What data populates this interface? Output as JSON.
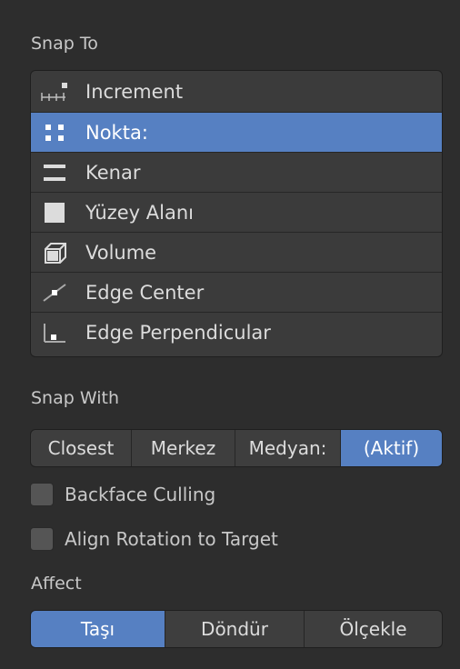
{
  "snap_to": {
    "label": "Snap To",
    "items": [
      {
        "label": "Increment",
        "icon": "increment-icon",
        "active": false
      },
      {
        "label": "Nokta:",
        "icon": "vertex-icon",
        "active": true
      },
      {
        "label": "Kenar",
        "icon": "edge-icon",
        "active": false
      },
      {
        "label": "Yüzey Alanı",
        "icon": "face-icon",
        "active": false
      },
      {
        "label": "Volume",
        "icon": "volume-icon",
        "active": false
      },
      {
        "label": "Edge Center",
        "icon": "edge-center-icon",
        "active": false
      },
      {
        "label": "Edge Perpendicular",
        "icon": "edge-perpendicular-icon",
        "active": false
      }
    ]
  },
  "snap_with": {
    "label": "Snap With",
    "options": [
      "Closest",
      "Merkez",
      "Medyan:",
      "(Aktif)"
    ],
    "selected": "(Aktif)"
  },
  "checkboxes": {
    "backface_culling": {
      "label": "Backface Culling",
      "checked": false
    },
    "align_rotation": {
      "label": "Align Rotation to Target",
      "checked": false
    }
  },
  "affect": {
    "label": "Affect",
    "options": [
      "Taşı",
      "Döndür",
      "Ölçekle"
    ],
    "selected": "Taşı"
  },
  "colors": {
    "accent": "#5680c2",
    "background": "#2d2d2d",
    "panel": "#3b3b3b"
  }
}
